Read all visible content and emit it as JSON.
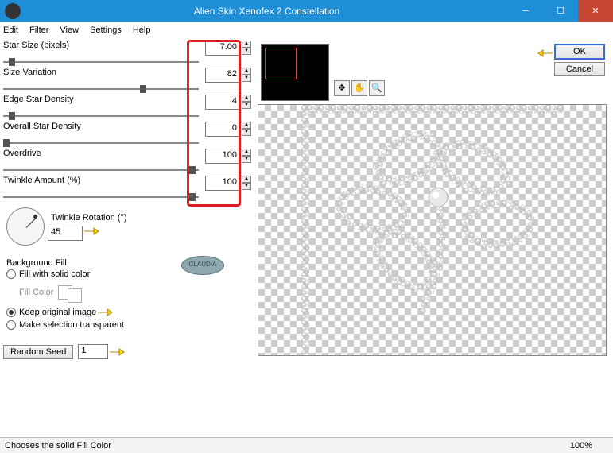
{
  "window": {
    "title": "Alien Skin Xenofex 2 Constellation"
  },
  "menu": [
    "Edit",
    "Filter",
    "View",
    "Settings",
    "Help"
  ],
  "params": [
    {
      "label": "Star Size (pixels)",
      "value": "7.00",
      "thumb": 3
    },
    {
      "label": "Size Variation",
      "value": "82",
      "thumb": 70
    },
    {
      "label": "Edge Star Density",
      "value": "4",
      "thumb": 3
    },
    {
      "label": "Overall Star Density",
      "value": "0",
      "thumb": 0
    },
    {
      "label": "Overdrive",
      "value": "100",
      "thumb": 95
    },
    {
      "label": "Twinkle Amount (%)",
      "value": "100",
      "thumb": 95
    }
  ],
  "twinkle_rotation": {
    "label": "Twinkle Rotation (°)",
    "value": "45"
  },
  "bgfill": {
    "title": "Background Fill",
    "opt_solid": "Fill with solid color",
    "fill_color_label": "Fill Color",
    "opt_keep": "Keep original image",
    "opt_trans": "Make selection transparent"
  },
  "random_seed": {
    "button": "Random Seed",
    "value": "1"
  },
  "buttons": {
    "ok": "OK",
    "cancel": "Cancel"
  },
  "status": {
    "text": "Chooses the solid Fill Color",
    "zoom": "100%"
  },
  "watermark": "CLAUDIA"
}
